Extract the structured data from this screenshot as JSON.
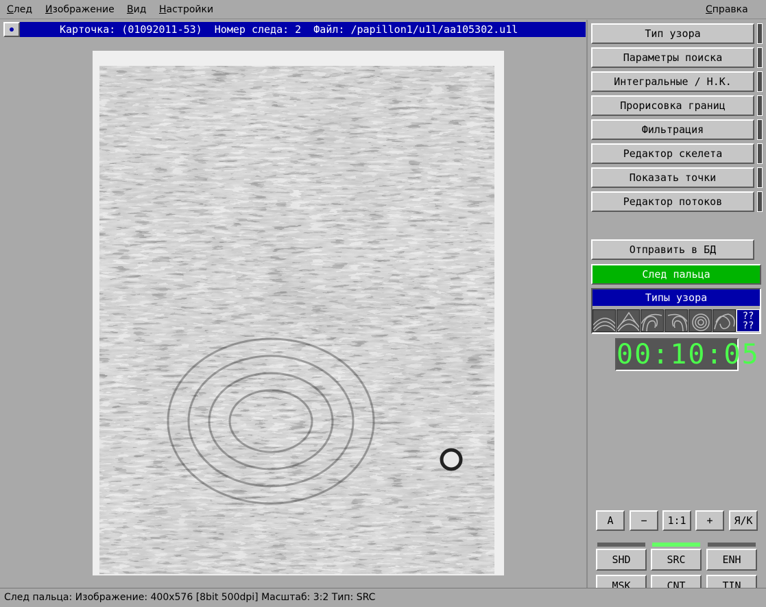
{
  "menu": {
    "sled": "След",
    "image": "Изображение",
    "view": "Вид",
    "settings": "Настройки",
    "help": "Справка"
  },
  "titlebar": {
    "text": "Карточка: (01092011-53)  Номер следа: 2  Файл: /papillon1/u1l/aa105302.u1l"
  },
  "right": {
    "buttons": [
      "Тип узора",
      "Параметры поиска",
      "Интегральные / Н.К.",
      "Прорисовка границ",
      "Фильтрация",
      "Редактор скелета",
      "Показать точки",
      "Редактор потоков"
    ],
    "send": "Отправить в БД",
    "finger": "След пальца",
    "types_title": "Типы узора",
    "unknown": "??\n??",
    "timer": "00:10:05",
    "zoom": {
      "a": "A",
      "minus": "−",
      "one": "1:1",
      "plus": "+",
      "lang": "Я/К"
    },
    "modes": {
      "shd": "SHD",
      "src": "SRC",
      "enh": "ENH",
      "msk": "MSK",
      "cnt": "CNT",
      "tin": "TIN"
    }
  },
  "colors": {
    "accent": "#0000aa",
    "green": "#00b400",
    "lcd": "#4cff4c"
  },
  "status": "След пальца: Изображение: 400x576 [8bit 500dpi] Масштаб: 3:2  Тип: SRC"
}
